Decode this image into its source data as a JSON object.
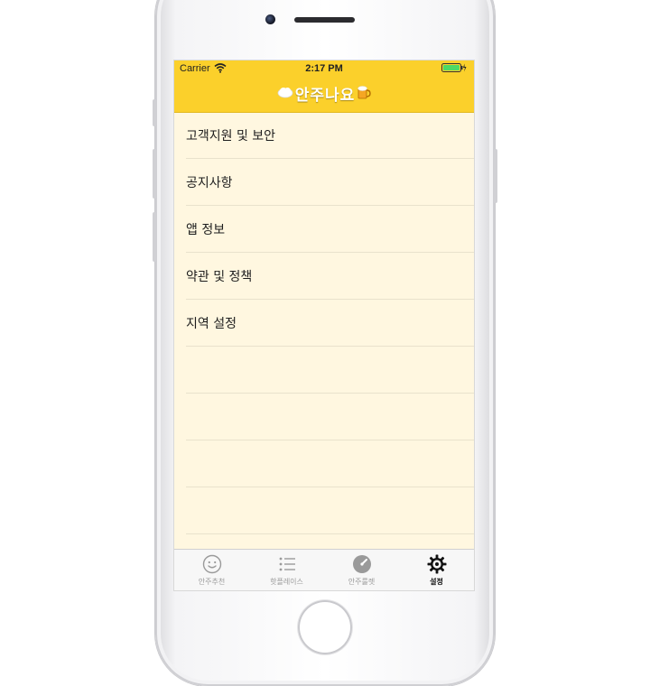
{
  "status_bar": {
    "carrier": "Carrier",
    "time": "2:17 PM",
    "battery_color": "#4cd964"
  },
  "nav": {
    "title": "안주나요",
    "left_icon": "cloud-icon",
    "right_icon": "beer-icon",
    "background_color": "#fbd02b"
  },
  "menu": {
    "items": [
      {
        "label": "고객지원 및 보안"
      },
      {
        "label": "공지사항"
      },
      {
        "label": "앱 정보"
      },
      {
        "label": "약관 및 정책"
      },
      {
        "label": "지역 설정"
      }
    ]
  },
  "tabs": [
    {
      "label": "안주추천",
      "icon": "smiley-icon",
      "active": false
    },
    {
      "label": "핫플레이스",
      "icon": "list-icon",
      "active": false
    },
    {
      "label": "안주룰렛",
      "icon": "roulette-icon",
      "active": false
    },
    {
      "label": "설정",
      "icon": "gear-icon",
      "active": true
    }
  ],
  "colors": {
    "content_background": "#fff7e0",
    "accent_yellow": "#fbd02b"
  }
}
